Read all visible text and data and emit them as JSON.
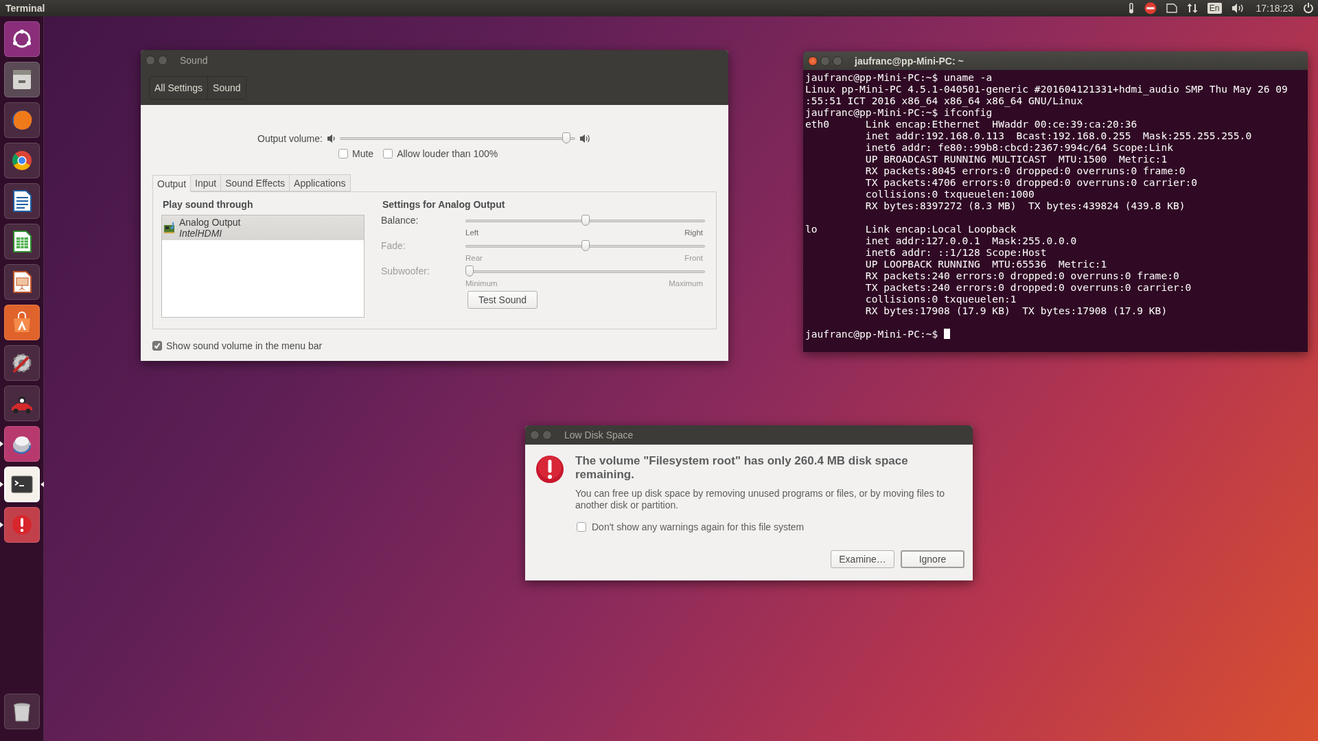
{
  "top_bar": {
    "app_title": "Terminal",
    "indicators": [
      {
        "kind": "thermometer"
      },
      {
        "kind": "no-entry"
      },
      {
        "kind": "card"
      },
      {
        "kind": "network"
      },
      {
        "kind": "keyboard",
        "text": "En"
      },
      {
        "kind": "volume"
      }
    ],
    "clock": "17:18:23",
    "power": {
      "kind": "power"
    }
  },
  "launcher": {
    "items": [
      {
        "kind": "dash",
        "running": false,
        "focused": false
      },
      {
        "kind": "files",
        "running": false,
        "focused": false
      },
      {
        "kind": "browser",
        "running": false,
        "focused": false
      },
      {
        "kind": "ring",
        "running": false,
        "focused": false
      },
      {
        "kind": "writer",
        "running": false,
        "focused": false
      },
      {
        "kind": "calc",
        "running": false,
        "focused": false
      },
      {
        "kind": "impress",
        "running": false,
        "focused": false
      },
      {
        "kind": "software",
        "running": false,
        "focused": false
      },
      {
        "kind": "settings",
        "running": false,
        "focused": false
      },
      {
        "kind": "racer",
        "running": false,
        "focused": false
      },
      {
        "kind": "disc",
        "running": true,
        "focused": false
      },
      {
        "kind": "terminal",
        "running": true,
        "focused": true
      },
      {
        "kind": "alert",
        "running": true,
        "focused": false
      }
    ],
    "trash": {
      "kind": "trash"
    }
  },
  "sound_window": {
    "title": "Sound",
    "breadcrumbs": [
      "All Settings",
      "Sound"
    ],
    "output_volume": {
      "label": "Output volume:",
      "level": 0.98
    },
    "options": [
      {
        "label": "Mute",
        "checked": false
      },
      {
        "label": "Allow louder than 100%",
        "checked": false
      }
    ],
    "tabs": [
      {
        "label": "Output",
        "selected": true
      },
      {
        "label": "Input",
        "selected": false
      },
      {
        "label": "Sound Effects",
        "selected": false
      },
      {
        "label": "Applications",
        "selected": false
      }
    ],
    "devices_heading": "Play sound through",
    "devices": [
      {
        "name": "Analog Output",
        "subtitle": "IntelHDMI",
        "selected": true
      }
    ],
    "settings_heading": "Settings for Analog Output",
    "sliders": [
      {
        "label": "Balance:",
        "min_label": "Left",
        "max_label": "Right",
        "level": 0.5,
        "disabled": false
      },
      {
        "label": "Fade:",
        "min_label": "Rear",
        "max_label": "Front",
        "level": 0.5,
        "disabled": true
      },
      {
        "label": "Subwoofer:",
        "min_label": "Minimum",
        "max_label": "Maximum",
        "level": 0,
        "disabled": true
      }
    ],
    "test_button": "Test Sound",
    "show_in_menu_bar": {
      "label": "Show sound volume in the menu bar",
      "checked": true
    }
  },
  "terminal": {
    "title": "jaufranc@pp-Mini-PC: ~",
    "sections": [
      {
        "lines": [
          "jaufranc@pp-Mini-PC:~$ uname -a",
          "Linux pp-Mini-PC 4.5.1-040501-generic #201604121331+hdmi_audio SMP Thu May 26 09",
          ":55:51 ICT 2016 x86_64 x86_64 x86_64 GNU/Linux",
          "jaufranc@pp-Mini-PC:~$ ifconfig",
          "eth0      Link encap:Ethernet  HWaddr 00:ce:39:ca:20:36",
          "          inet addr:192.168.0.113  Bcast:192.168.0.255  Mask:255.255.255.0",
          "          inet6 addr: fe80::99b8:cbcd:2367:994c/64 Scope:Link",
          "          UP BROADCAST RUNNING MULTICAST  MTU:1500  Metric:1",
          "          RX packets:8045 errors:0 dropped:0 overruns:0 frame:0",
          "          TX packets:4706 errors:0 dropped:0 overruns:0 carrier:0",
          "          collisions:0 txqueuelen:1000",
          "          RX bytes:8397272 (8.3 MB)  TX bytes:439824 (439.8 KB)"
        ]
      },
      {
        "lines": [
          "lo        Link encap:Local Loopback",
          "          inet addr:127.0.0.1  Mask:255.0.0.0",
          "          inet6 addr: ::1/128 Scope:Host",
          "          UP LOOPBACK RUNNING  MTU:65536  Metric:1",
          "          RX packets:240 errors:0 dropped:0 overruns:0 frame:0",
          "          TX packets:240 errors:0 dropped:0 overruns:0 carrier:0",
          "          collisions:0 txqueuelen:1",
          "          RX bytes:17908 (17.9 KB)  TX bytes:17908 (17.9 KB)"
        ]
      }
    ],
    "prompt": {
      "text": "jaufranc@pp-Mini-PC:~$",
      "cursor": true
    }
  },
  "disk_dialog": {
    "title": "Low Disk Space",
    "heading": "The volume \"Filesystem root\" has only 260.4 MB disk space remaining.",
    "body": "You can free up disk space by removing unused programs or files, or by moving files to another disk or partition.",
    "option": {
      "label": "Don't show any warnings again for this file system",
      "checked": false
    },
    "buttons": [
      {
        "label": "Examine…",
        "default": false
      },
      {
        "label": "Ignore",
        "default": true
      }
    ]
  }
}
